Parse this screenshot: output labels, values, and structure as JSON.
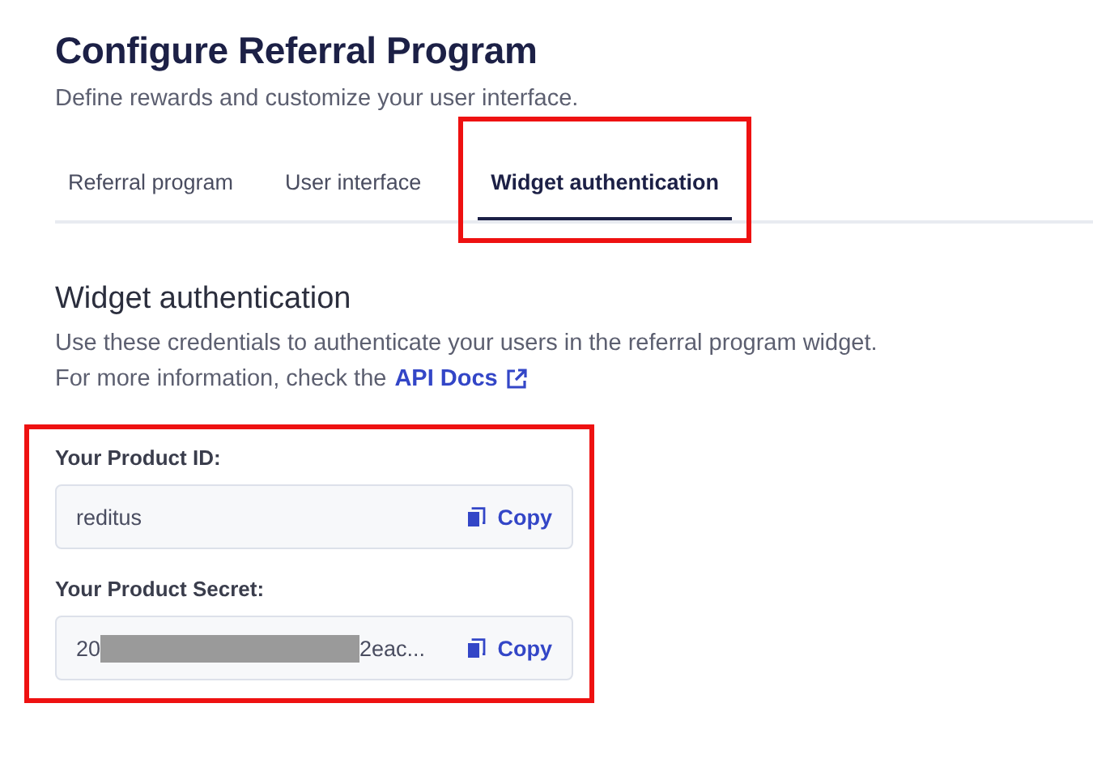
{
  "header": {
    "title": "Configure Referral Program",
    "subtitle": "Define rewards and customize your user interface."
  },
  "tabs": [
    {
      "label": "Referral program",
      "selected": false
    },
    {
      "label": "User interface",
      "selected": false
    },
    {
      "label": "Widget authentication",
      "selected": true,
      "highlighted": true
    }
  ],
  "section": {
    "title": "Widget authentication",
    "description": "Use these credentials to authenticate your users in the referral program widget.",
    "more_info": "For more information, check the",
    "link": "API Docs"
  },
  "credentials_highlighted": true,
  "credentials": [
    {
      "label": "Your Product ID:",
      "value": "reditus",
      "redacted": false,
      "copy": "Copy"
    },
    {
      "label": "Your Product Secret:",
      "value": "20",
      "redacted": true,
      "value_end": "2eac...",
      "copy": "Copy"
    }
  ]
}
